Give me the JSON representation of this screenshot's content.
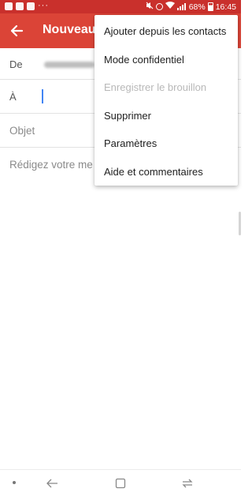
{
  "status_bar": {
    "battery": "68%",
    "time": "16:45",
    "icons": [
      "gallery-icon",
      "facebook-icon",
      "youtube-icon",
      "more-dots-icon",
      "mute-icon",
      "alarm-icon",
      "wifi-icon",
      "signal-icon",
      "battery-icon"
    ],
    "more": "···"
  },
  "app_bar": {
    "title": "Nouveau m",
    "back_icon": "arrow-left-icon",
    "background": "#db4437"
  },
  "compose": {
    "from_label": "De",
    "to_label": "À",
    "subject_placeholder": "Objet",
    "body_placeholder": "Rédigez votre me"
  },
  "overflow_menu": {
    "items": [
      {
        "label": "Ajouter depuis les contacts",
        "disabled": false
      },
      {
        "label": "Mode confidentiel",
        "disabled": false
      },
      {
        "label": "Enregistrer le brouillon",
        "disabled": true
      },
      {
        "label": "Supprimer",
        "disabled": false
      },
      {
        "label": "Paramètres",
        "disabled": false
      },
      {
        "label": "Aide et commentaires",
        "disabled": false
      }
    ]
  },
  "nav_bar": {
    "buttons": [
      "dot-icon",
      "back-nav-icon",
      "home-square-icon",
      "recents-icon"
    ]
  },
  "colors": {
    "accent": "#db4437",
    "status_bar": "#c9302c",
    "cursor": "#4285f4"
  }
}
